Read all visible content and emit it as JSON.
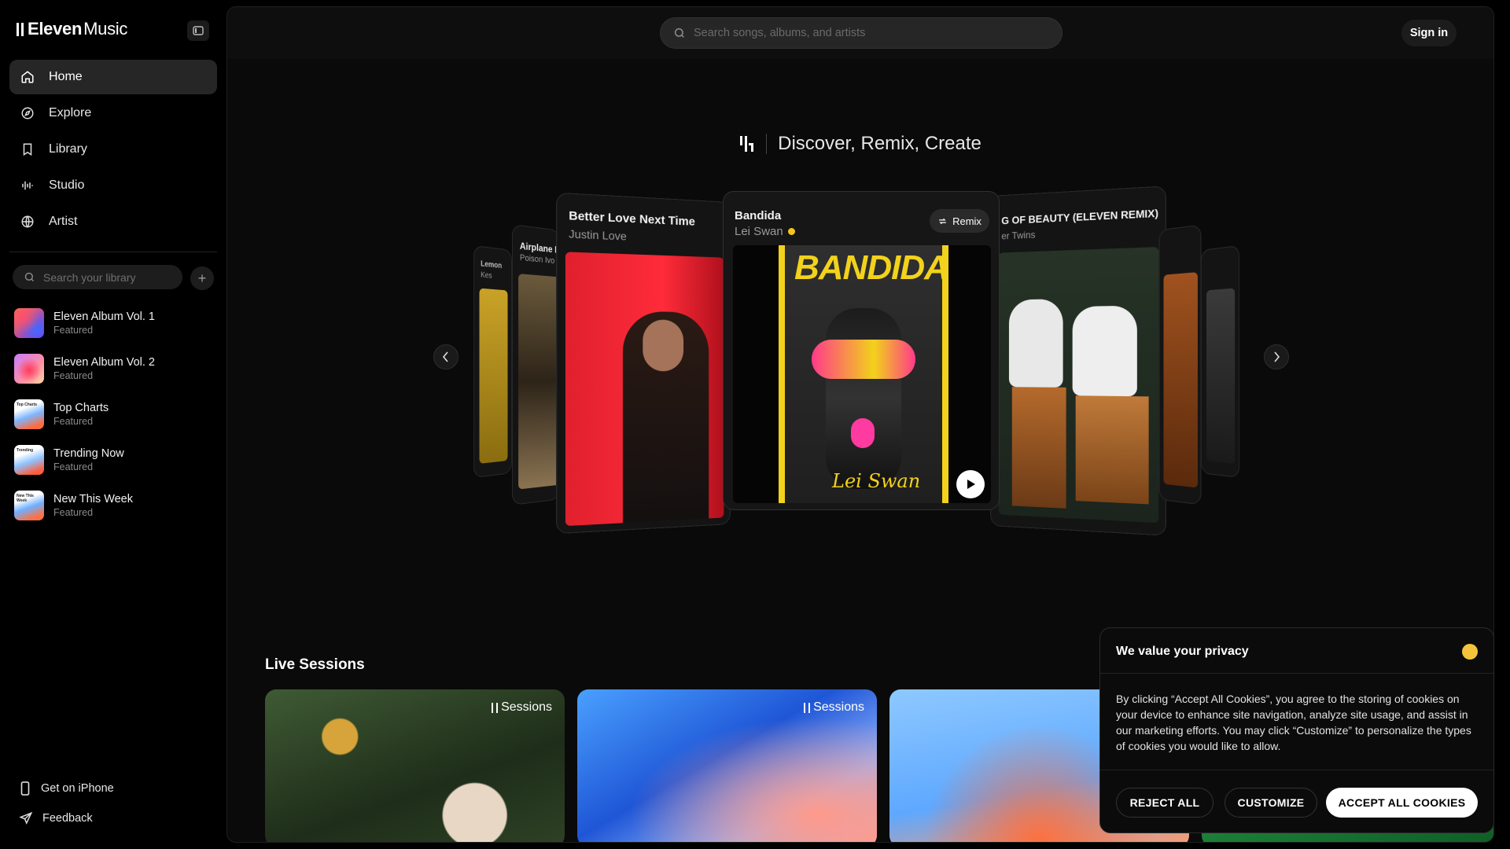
{
  "brand": {
    "bold": "Eleven",
    "light": "Music"
  },
  "nav": [
    {
      "label": "Home",
      "icon": "home-icon",
      "active": true
    },
    {
      "label": "Explore",
      "icon": "compass-icon"
    },
    {
      "label": "Library",
      "icon": "bookmark-icon"
    },
    {
      "label": "Studio",
      "icon": "waveform-icon"
    },
    {
      "label": "Artist",
      "icon": "globe-icon"
    }
  ],
  "library": {
    "search_placeholder": "Search your library",
    "items": [
      {
        "title": "Eleven Album Vol. 1",
        "subtitle": "Featured",
        "thumb_label": ""
      },
      {
        "title": "Eleven Album Vol. 2",
        "subtitle": "Featured",
        "thumb_label": ""
      },
      {
        "title": "Top Charts",
        "subtitle": "Featured",
        "thumb_label": "Top Charts"
      },
      {
        "title": "Trending Now",
        "subtitle": "Featured",
        "thumb_label": "Trending"
      },
      {
        "title": "New This Week",
        "subtitle": "Featured",
        "thumb_label": "New This Week"
      }
    ]
  },
  "sidebar_bottom": {
    "iphone": "Get on iPhone",
    "feedback": "Feedback"
  },
  "header": {
    "search_placeholder": "Search songs, albums, and artists",
    "signin": "Sign in"
  },
  "hero": {
    "title": "Discover, Remix, Create"
  },
  "carousel": {
    "center": {
      "title": "Bandida",
      "artist": "Lei Swan",
      "remix_label": "Remix",
      "art_text": "BANDIDA",
      "art_signature": "Lei Swan"
    },
    "left1": {
      "title": "Better Love Next Time",
      "artist": "Justin Love"
    },
    "left2": {
      "title": "Airplane M",
      "artist": "Poison Ivo"
    },
    "left3": {
      "title": "Lemon",
      "artist": "Kes"
    },
    "right1": {
      "title": "G OF BEAUTY (ELEVEN REMIX)",
      "artist": "er Twins"
    }
  },
  "live_sessions": {
    "title": "Live Sessions",
    "brand_label": "Sessions"
  },
  "cookie": {
    "title": "We value your privacy",
    "body": "By clicking “Accept All Cookies”, you agree to the storing of cookies on your device to enhance site navigation, analyze site usage, and assist in our marketing efforts. You may click “Customize” to personalize the types of cookies you would like to allow.",
    "reject": "REJECT ALL",
    "customize": "CUSTOMIZE",
    "accept": "ACCEPT ALL COOKIES"
  }
}
